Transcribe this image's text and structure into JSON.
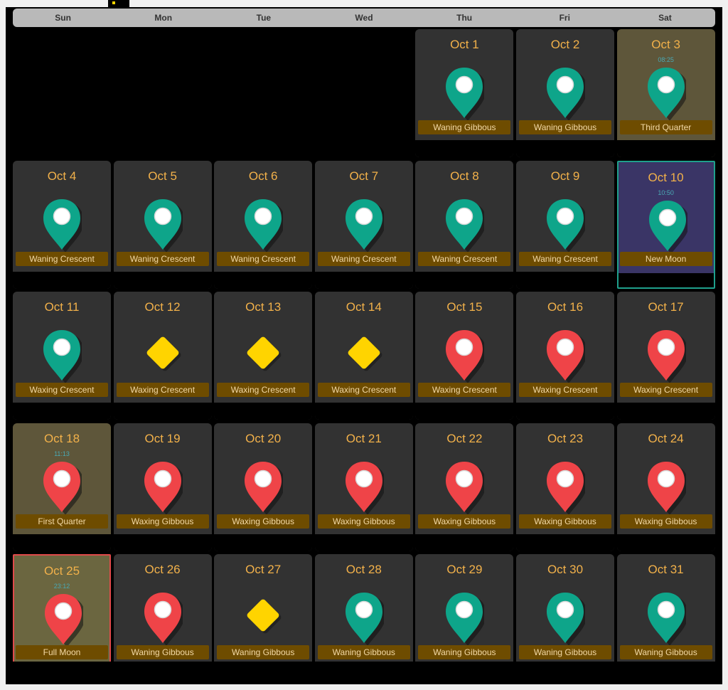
{
  "weekdays": [
    "Sun",
    "Mon",
    "Tue",
    "Wed",
    "Thu",
    "Fri",
    "Sat"
  ],
  "colors": {
    "date_text": "#f2b14a",
    "time_text": "#49a9b4",
    "marker_teal": "#0ea58a",
    "marker_red": "#ef4448",
    "marker_yellow": "#ffd400",
    "phase_bg": "#6e4c00"
  },
  "days": [
    {
      "label": "Oct 1",
      "phase": "Waning Gibbous",
      "icon": "teal-pin-icon"
    },
    {
      "label": "Oct 2",
      "phase": "Waning Gibbous",
      "icon": "teal-pin-icon"
    },
    {
      "label": "Oct 3",
      "phase": "Third Quarter",
      "icon": "teal-pin-icon",
      "time": "08:25",
      "style": "quarter"
    },
    {
      "label": "Oct 4",
      "phase": "Waning Crescent",
      "icon": "teal-pin-icon"
    },
    {
      "label": "Oct 5",
      "phase": "Waning Crescent",
      "icon": "teal-pin-icon"
    },
    {
      "label": "Oct 6",
      "phase": "Waning Crescent",
      "icon": "teal-pin-icon"
    },
    {
      "label": "Oct 7",
      "phase": "Waning Crescent",
      "icon": "teal-pin-icon"
    },
    {
      "label": "Oct 8",
      "phase": "Waning Crescent",
      "icon": "teal-pin-icon"
    },
    {
      "label": "Oct 9",
      "phase": "Waning Crescent",
      "icon": "teal-pin-icon"
    },
    {
      "label": "Oct 10",
      "phase": "New Moon",
      "icon": "teal-pin-icon",
      "time": "10:50",
      "style": "newmoon"
    },
    {
      "label": "Oct 11",
      "phase": "Waxing Crescent",
      "icon": "teal-pin-icon"
    },
    {
      "label": "Oct 12",
      "phase": "Waxing Crescent",
      "icon": "yellow-diamond-icon"
    },
    {
      "label": "Oct 13",
      "phase": "Waxing Crescent",
      "icon": "yellow-diamond-icon"
    },
    {
      "label": "Oct 14",
      "phase": "Waxing Crescent",
      "icon": "yellow-diamond-icon"
    },
    {
      "label": "Oct 15",
      "phase": "Waxing Crescent",
      "icon": "red-pin-icon"
    },
    {
      "label": "Oct 16",
      "phase": "Waxing Crescent",
      "icon": "red-pin-icon"
    },
    {
      "label": "Oct 17",
      "phase": "Waxing Crescent",
      "icon": "red-pin-icon"
    },
    {
      "label": "Oct 18",
      "phase": "First Quarter",
      "icon": "red-pin-icon",
      "time": "11:13",
      "style": "quarter"
    },
    {
      "label": "Oct 19",
      "phase": "Waxing Gibbous",
      "icon": "red-pin-icon"
    },
    {
      "label": "Oct 20",
      "phase": "Waxing Gibbous",
      "icon": "red-pin-icon"
    },
    {
      "label": "Oct 21",
      "phase": "Waxing Gibbous",
      "icon": "red-pin-icon"
    },
    {
      "label": "Oct 22",
      "phase": "Waxing Gibbous",
      "icon": "red-pin-icon"
    },
    {
      "label": "Oct 23",
      "phase": "Waxing Gibbous",
      "icon": "red-pin-icon"
    },
    {
      "label": "Oct 24",
      "phase": "Waxing Gibbous",
      "icon": "red-pin-icon"
    },
    {
      "label": "Oct 25",
      "phase": "Full Moon",
      "icon": "red-pin-icon",
      "time": "23:12",
      "style": "fullmoon"
    },
    {
      "label": "Oct 26",
      "phase": "Waning Gibbous",
      "icon": "red-pin-icon"
    },
    {
      "label": "Oct 27",
      "phase": "Waning Gibbous",
      "icon": "yellow-diamond-icon"
    },
    {
      "label": "Oct 28",
      "phase": "Waning Gibbous",
      "icon": "teal-pin-icon"
    },
    {
      "label": "Oct 29",
      "phase": "Waning Gibbous",
      "icon": "teal-pin-icon"
    },
    {
      "label": "Oct 30",
      "phase": "Waning Gibbous",
      "icon": "teal-pin-icon"
    },
    {
      "label": "Oct 31",
      "phase": "Waning Gibbous",
      "icon": "teal-pin-icon"
    }
  ]
}
